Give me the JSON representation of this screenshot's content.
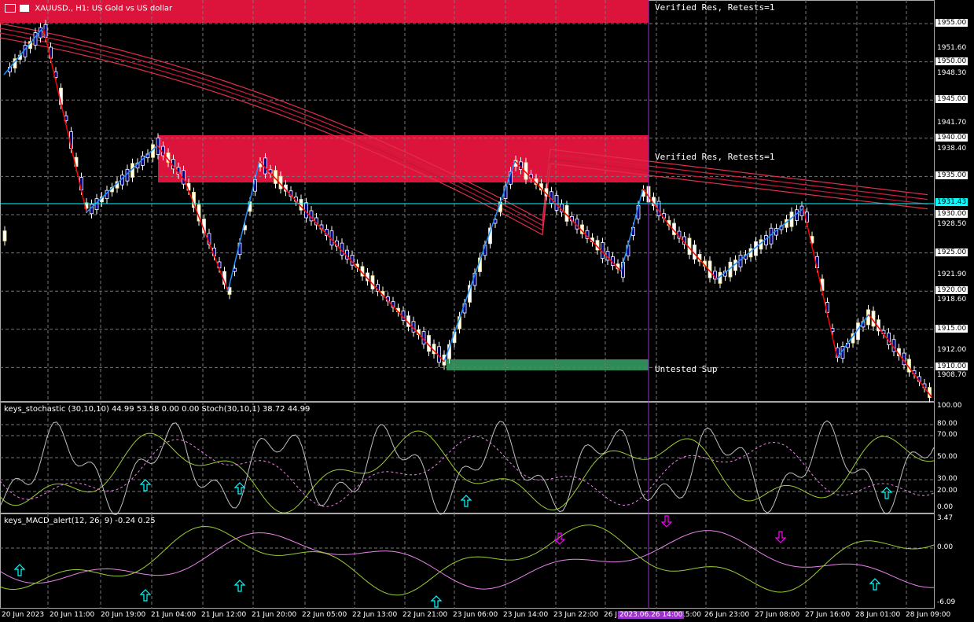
{
  "header": {
    "symbol": "XAUUSD.",
    "timeframe": "H1",
    "description": "US Gold vs US dollar",
    "title_text": "XAUUSD., H1:  US Gold vs US dollar"
  },
  "zones": {
    "top": "Verified Res, Retests=1",
    "mid": "Verified Res, Retests=1",
    "bottom": "Untested Sup"
  },
  "price_axis": {
    "labels": [
      "1951.60",
      "1948.30",
      "1941.70",
      "1938.40",
      "1928.50",
      "1921.90",
      "1918.60",
      "1912.00",
      "1908.70"
    ],
    "tags": [
      "1955.00",
      "1950.00",
      "1945.00",
      "1940.00",
      "1935.00",
      "1930.00",
      "1925.00",
      "1920.00",
      "1915.00",
      "1910.00"
    ],
    "current": "1931.43"
  },
  "stoch": {
    "title": "keys_stochastic (30,10,10) 44.99 53.58 0.00 0.00 Stoch(30,10,1) 38.72 44.99",
    "levels": [
      "100.00",
      "80.00",
      "70.00",
      "50.00",
      "30.00",
      "20.00",
      "0.00"
    ]
  },
  "macd": {
    "title": "keys_MACD_alert(12, 26, 9) -0.24 0.25",
    "levels": [
      "3.47",
      "0.00",
      "-6.09"
    ]
  },
  "time_axis": {
    "labels": [
      "20 Jun 2023",
      "20 Jun 11:00",
      "20 Jun 19:00",
      "21 Jun 04:00",
      "21 Jun 12:00",
      "21 Jun 20:00",
      "22 Jun 05:00",
      "22 Jun 13:00",
      "22 Jun 21:00",
      "23 Jun 06:00",
      "23 Jun 14:00",
      "23 Jun 22:00",
      "26 J",
      "15:00",
      "26 Jun 23:00",
      "27 Jun 08:00",
      "27 Jun 16:00",
      "28 Jun 01:00",
      "28 Jun 09:00"
    ],
    "cursor": "2023.06.26 14:00"
  },
  "colors": {
    "bg": "#000000",
    "resistance": "#dc143c",
    "support": "#2e8b57",
    "zigzag_up": "#1e90ff",
    "zigzag_down": "#ff0000",
    "current_price": "#00ffff",
    "cursor": "#9932cc"
  }
}
